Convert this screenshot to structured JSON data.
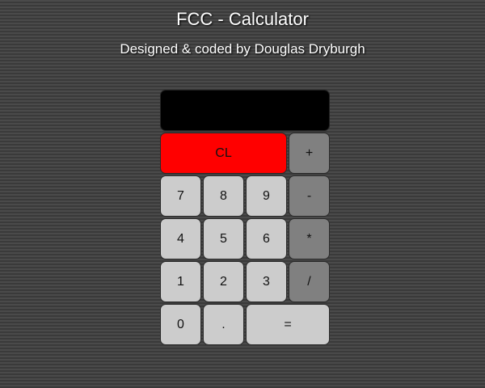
{
  "header": {
    "title": "FCC - Calculator",
    "subtitle": "Designed & coded by Douglas Dryburgh"
  },
  "display": {
    "value": ""
  },
  "keys": {
    "clear": "CL",
    "plus": "+",
    "seven": "7",
    "eight": "8",
    "nine": "9",
    "minus": "-",
    "four": "4",
    "five": "5",
    "six": "6",
    "multiply": "*",
    "one": "1",
    "two": "2",
    "three": "3",
    "divide": "/",
    "zero": "0",
    "decimal": ".",
    "equals": "="
  },
  "colors": {
    "clear_key": "#ff0000",
    "number_key": "#cccccc",
    "operator_key": "#808080",
    "display_background": "#000000"
  }
}
